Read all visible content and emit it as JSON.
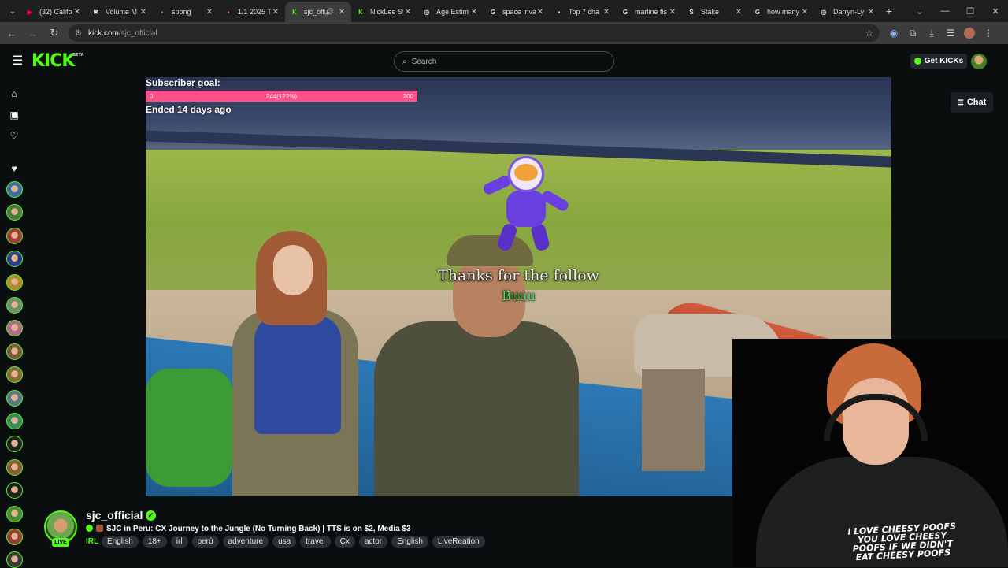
{
  "browser": {
    "tabs": [
      {
        "title": "(32) Califo",
        "fav_color": "#ff0033",
        "fav_glyph": "▶"
      },
      {
        "title": "Volume M",
        "fav_color": "#ffffff",
        "fav_glyph": "✉"
      },
      {
        "title": "spong",
        "fav_color": "#6e7dff",
        "fav_glyph": "▪"
      },
      {
        "title": "1/1 2025 T",
        "fav_color": "#ff5a5a",
        "fav_glyph": "▪"
      },
      {
        "title": "sjc_offi",
        "fav_color": "#53fc18",
        "fav_glyph": "K"
      },
      {
        "title": "NickLee St",
        "fav_color": "#53fc18",
        "fav_glyph": "K"
      },
      {
        "title": "Age Estim",
        "fav_color": "#dddddd",
        "fav_glyph": "◎"
      },
      {
        "title": "space inva",
        "fav_color": "#dddddd",
        "fav_glyph": "G"
      },
      {
        "title": "Top 7 cha",
        "fav_color": "#f4d03f",
        "fav_glyph": "▪"
      },
      {
        "title": "marline fis",
        "fav_color": "#dddddd",
        "fav_glyph": "G"
      },
      {
        "title": "Stake",
        "fav_color": "#dddddd",
        "fav_glyph": "S"
      },
      {
        "title": "how many",
        "fav_color": "#dddddd",
        "fav_glyph": "G"
      },
      {
        "title": "Darryn-Ly",
        "fav_color": "#dddddd",
        "fav_glyph": "◎"
      }
    ],
    "active_tab_index": 4,
    "url_host": "kick.com",
    "url_path": "/sjc_official"
  },
  "header": {
    "logo": "KICK",
    "logo_badge": "BETA",
    "search_placeholder": "Search",
    "get_kicks_label": "Get KICKs",
    "accent": "#53fc18"
  },
  "player": {
    "goal_title": "Subscriber goal:",
    "goal_min": "0",
    "goal_progress_label": "244(122%)",
    "goal_max": "200",
    "goal_progress": 1.0,
    "goal_ended": "Ended 14 days ago",
    "alert_main": "Thanks for the follow",
    "alert_name": "Buuu"
  },
  "webcam": {
    "shirt_text": "I LOVE CHEESY POOFS YOU LOVE CHEESY POOFS IF WE DIDN'T EAT CHEESY POOFS"
  },
  "chat": {
    "button_label": "Chat"
  },
  "stream": {
    "streamer": "sjc_official",
    "live_label": "LIVE",
    "title": "SJC in Peru: CX Journey to the Jungle (No Turning Back) | TTS is on $2, Media $3",
    "category": "IRL",
    "tags": [
      "English",
      "18+",
      "irl",
      "perú",
      "adventure",
      "usa",
      "travel",
      "Cx",
      "actor",
      "English",
      "LiveReation"
    ]
  },
  "sidebar": {
    "avatar_colors": [
      "#3a6ea5",
      "#4d7a3a",
      "#a33b3b",
      "#2f3d8a",
      "#b48a2f",
      "#6a8f6a",
      "#b46a8f",
      "#7a5a3a",
      "#8a6a3a",
      "#5a7a8a",
      "#3a8a5a",
      "#222222",
      "#8a5a3a",
      "#1f1f1f",
      "#4a8a3a",
      "#9a3a3a",
      "#3a3a3a"
    ]
  }
}
